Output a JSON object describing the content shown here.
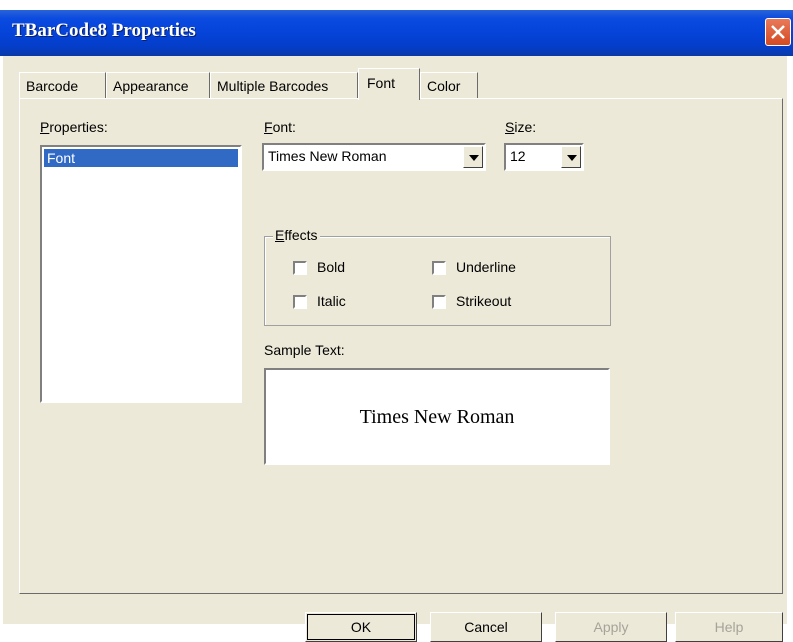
{
  "window": {
    "title": "TBarCode8 Properties"
  },
  "tabs": [
    {
      "label": "Barcode"
    },
    {
      "label": "Appearance"
    },
    {
      "label": "Multiple Barcodes"
    },
    {
      "label": "Font",
      "active": true
    },
    {
      "label": "Color"
    }
  ],
  "properties": {
    "label": "Properties:",
    "items": [
      "Font"
    ]
  },
  "font": {
    "label": "Font:",
    "value": "Times New Roman"
  },
  "size": {
    "label": "Size:",
    "value": "12"
  },
  "effects": {
    "title": "Effects",
    "bold": "Bold",
    "italic": "Italic",
    "underline": "Underline",
    "strikeout": "Strikeout"
  },
  "sample": {
    "label": "Sample Text:",
    "text": "Times New Roman"
  },
  "buttons": {
    "ok": "OK",
    "cancel": "Cancel",
    "apply": "Apply",
    "help": "Help"
  }
}
